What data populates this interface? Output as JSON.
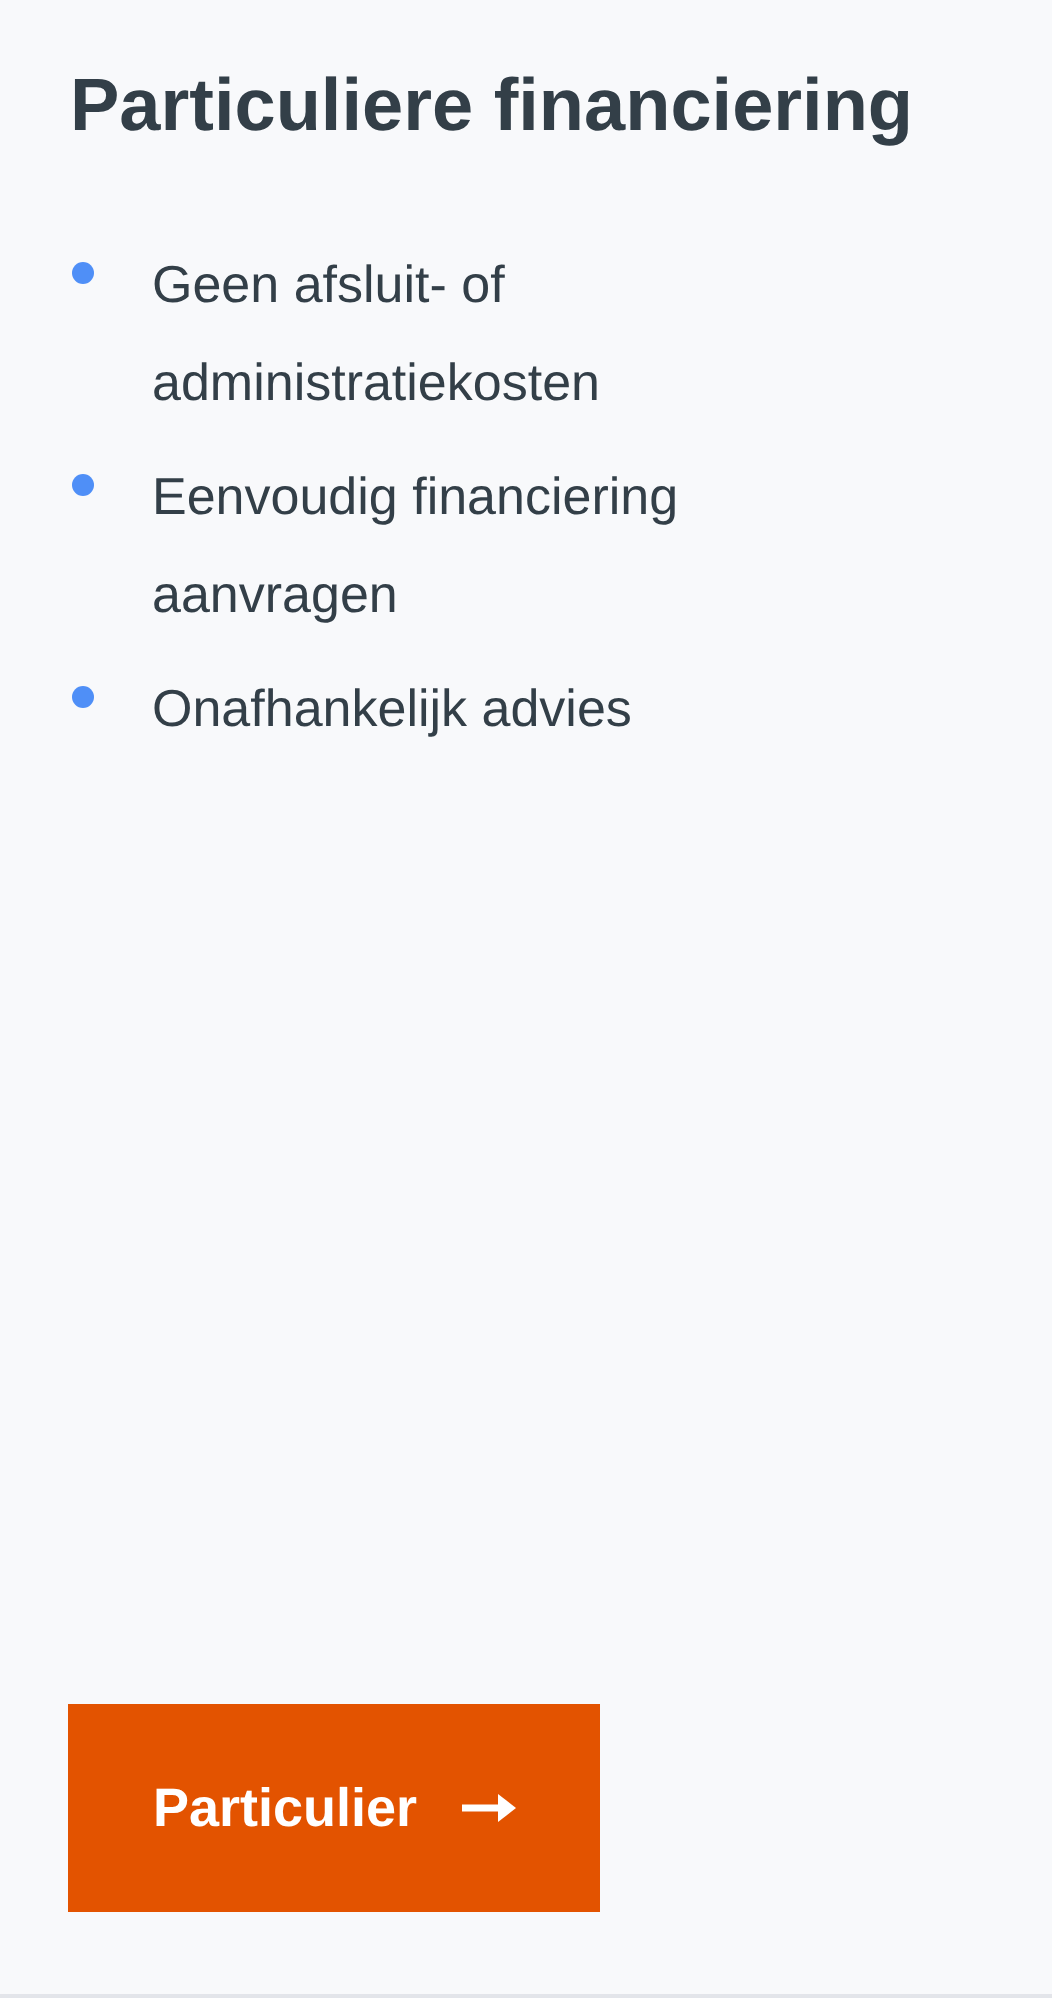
{
  "title": "Particuliere financiering",
  "features": [
    {
      "text": "Geen afsluit- of administratiekosten"
    },
    {
      "text": "Eenvoudig financiering aanvragen"
    },
    {
      "text": "Onafhankelijk advies"
    }
  ],
  "button": {
    "label": "Particulier"
  }
}
